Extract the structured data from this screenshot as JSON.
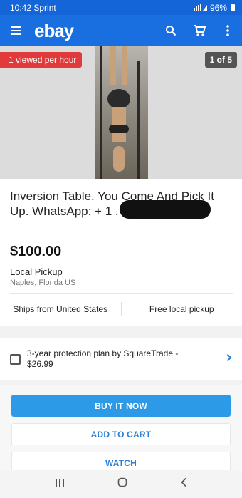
{
  "status_bar": {
    "time": "10:42",
    "carrier": "Sprint",
    "battery": "96%"
  },
  "app_bar": {
    "logo": "ebay"
  },
  "gallery": {
    "viewed_badge": "1 viewed per hour",
    "count_badge": "1 of 5"
  },
  "item": {
    "title": "Inversion Table. You Come And Pick It Up. WhatsApp: + 1                 . Assembled.",
    "price": "$100.00",
    "pickup_label": "Local Pickup",
    "pickup_location": "Naples, Florida US",
    "ships_from": "Ships from United States",
    "free_pickup": "Free local pickup"
  },
  "protection": {
    "label": "3-year protection plan by SquareTrade - $26.99"
  },
  "actions": {
    "buy_now": "BUY IT NOW",
    "add_to_cart": "ADD TO CART",
    "watch": "WATCH"
  },
  "colors": {
    "brand_blue": "#1a6fe0",
    "primary_button": "#2d9ae8",
    "badge_red": "#e03a3a"
  },
  "icons": [
    "menu-icon",
    "search-icon",
    "cart-icon",
    "more-vert-icon",
    "chevron-right-icon",
    "recents-icon",
    "home-icon",
    "back-icon"
  ]
}
